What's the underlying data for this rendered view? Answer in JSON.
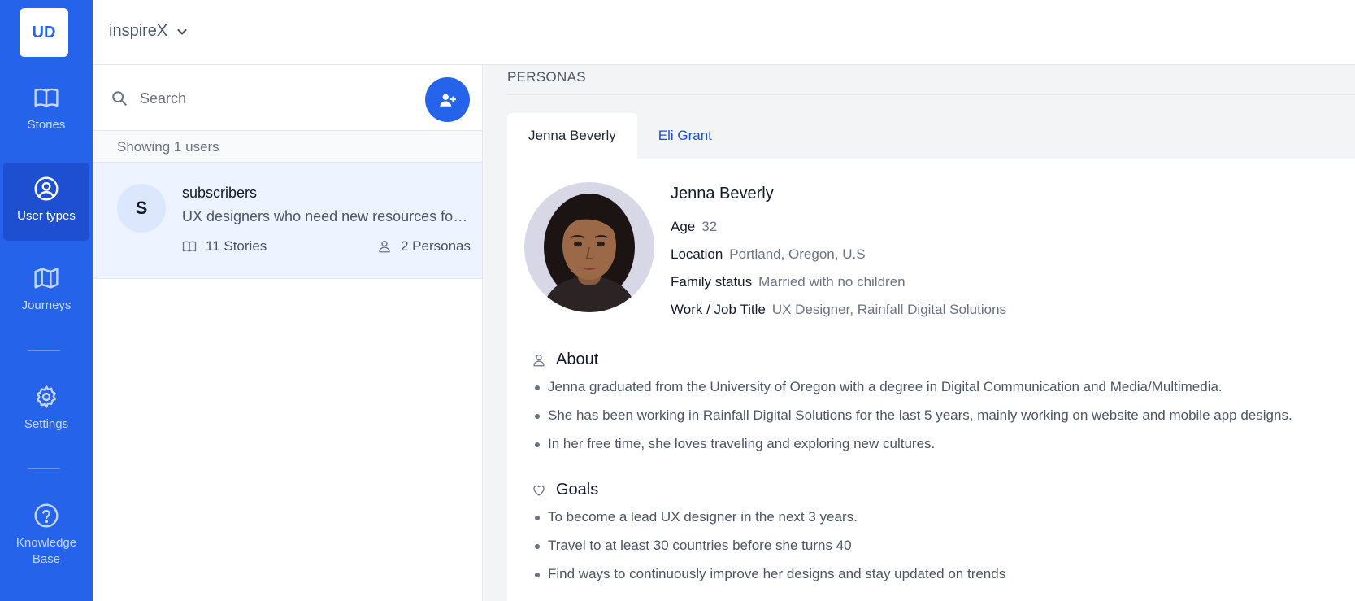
{
  "rail": {
    "logo": "UD",
    "items": [
      {
        "label": "Stories",
        "icon": "book-open-icon"
      },
      {
        "label": "User types",
        "icon": "user-circle-icon",
        "active": true
      },
      {
        "label": "Journeys",
        "icon": "map-icon"
      },
      {
        "label": "Settings",
        "icon": "gear-icon"
      },
      {
        "label": "Knowledge Base",
        "icon": "help-circle-icon"
      }
    ]
  },
  "topbar": {
    "workspace": "inspireX",
    "workspace_icon": "chevron-down-icon"
  },
  "user_list": {
    "search_placeholder": "Search",
    "add_icon": "user-plus-icon",
    "count_text": "Showing 1 users",
    "users": [
      {
        "initial": "S",
        "name": "subscribers",
        "description": "UX designers who need new resources for their work",
        "stories": "11 Stories",
        "personas": "2 Personas"
      }
    ]
  },
  "main": {
    "section_title": "PERSONAS",
    "tabs": [
      {
        "label": "Jenna Beverly",
        "active": true
      },
      {
        "label": "Eli Grant",
        "active": false
      }
    ],
    "persona": {
      "name": "Jenna Beverly",
      "fields": [
        {
          "label": "Age",
          "value": "32"
        },
        {
          "label": "Location",
          "value": "Portland, Oregon, U.S"
        },
        {
          "label": "Family status",
          "value": "Married with no children"
        },
        {
          "label": "Work / Job Title",
          "value": "UX Designer, Rainfall Digital Solutions"
        }
      ],
      "about_title": "About",
      "about": [
        "Jenna graduated from the University of Oregon with a degree in Digital Communication and Media/Multimedia.",
        "She has been working in Rainfall Digital Solutions for the last 5 years, mainly working on website and mobile app designs.",
        "In her free time, she loves traveling and exploring new cultures."
      ],
      "goals_title": "Goals",
      "goals": [
        "To become a lead UX designer in the next 3 years.",
        "Travel to at least 30 countries before she turns 40",
        "Find ways to continuously improve her designs and stay updated on trends"
      ]
    }
  },
  "colors": {
    "accent": "#2563eb",
    "rail_active": "#1d4fd0",
    "card_selected": "#eef4ff"
  }
}
